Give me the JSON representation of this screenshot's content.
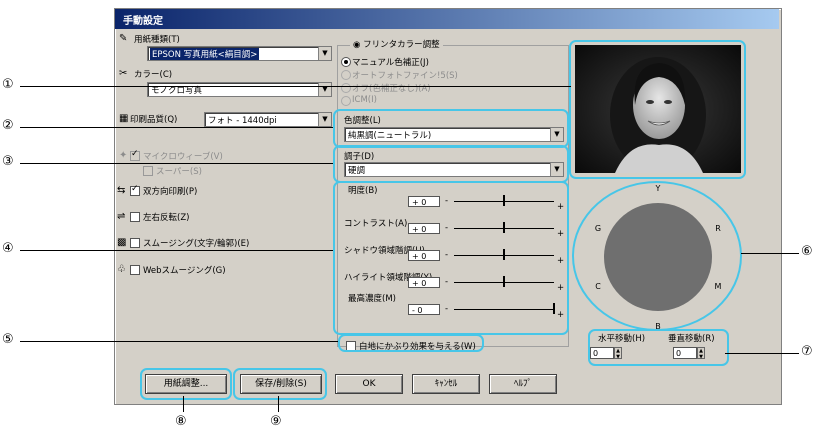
{
  "window": {
    "title": "手動設定"
  },
  "paper_type": {
    "label": "用紙種類(T)",
    "value": "EPSON 写真用紙<絹目調>"
  },
  "color": {
    "label": "カラー(C)",
    "value": "モノクロ写真"
  },
  "print_quality": {
    "label": "印刷品質(Q)",
    "value": "フォト - 1440dpi"
  },
  "options": {
    "micro_weave": "マイクロウィーブ(V)",
    "super": "スーパー(S)",
    "bidirectional": "双方向印刷(P)",
    "mirror": "左右反転(Z)",
    "smoothing": "スムージング(文字/輪郭)(E)",
    "web_smoothing": "Webスムージング(G)"
  },
  "color_adjust": {
    "title": "フリンタカラー調整",
    "radios": [
      "マニュアル色補正(J)",
      "オートフォトファイン!5(S)",
      "オフ(色補正なし)(A)",
      "ICM(I)"
    ],
    "tone_label": "色調整(L)",
    "tone_value": "純黒調(ニュートラル)",
    "mode_label": "調子(D)",
    "mode_value": "硬調"
  },
  "sliders": [
    {
      "label": "明度(B)",
      "value": "+ 0",
      "level": 0.5
    },
    {
      "label": "コントラスト(A)",
      "value": "+ 0",
      "level": 0.5
    },
    {
      "label": "シャドウ領域階調(U)",
      "value": "+ 0",
      "level": 0.5
    },
    {
      "label": "ハイライト領域階調(Y)",
      "value": "+ 0",
      "level": 0.5
    },
    {
      "label": "最高濃度(M)",
      "value": "- 0",
      "level": 1.0
    }
  ],
  "white_border": {
    "label": "白地にかぶり効果を与える(W)"
  },
  "color_circle": {
    "labels": [
      "Y",
      "R",
      "M",
      "B",
      "C",
      "G"
    ],
    "fill": "#6f6f6f"
  },
  "horizontal_shift": {
    "label": "水平移動(H)",
    "value": "0"
  },
  "vertical_shift": {
    "label": "垂直移動(R)",
    "value": "0"
  },
  "buttons": {
    "paper_adjust": "用紙調整...",
    "save_delete": "保存/削除(S)",
    "ok": "OK",
    "cancel": "ｷｬﾝｾﾙ",
    "help": "ﾍﾙﾌﾟ"
  },
  "callouts": [
    "①",
    "②",
    "③",
    "④",
    "⑤",
    "⑥",
    "⑦",
    "⑧",
    "⑨"
  ],
  "accent_color": "#47c6e8"
}
